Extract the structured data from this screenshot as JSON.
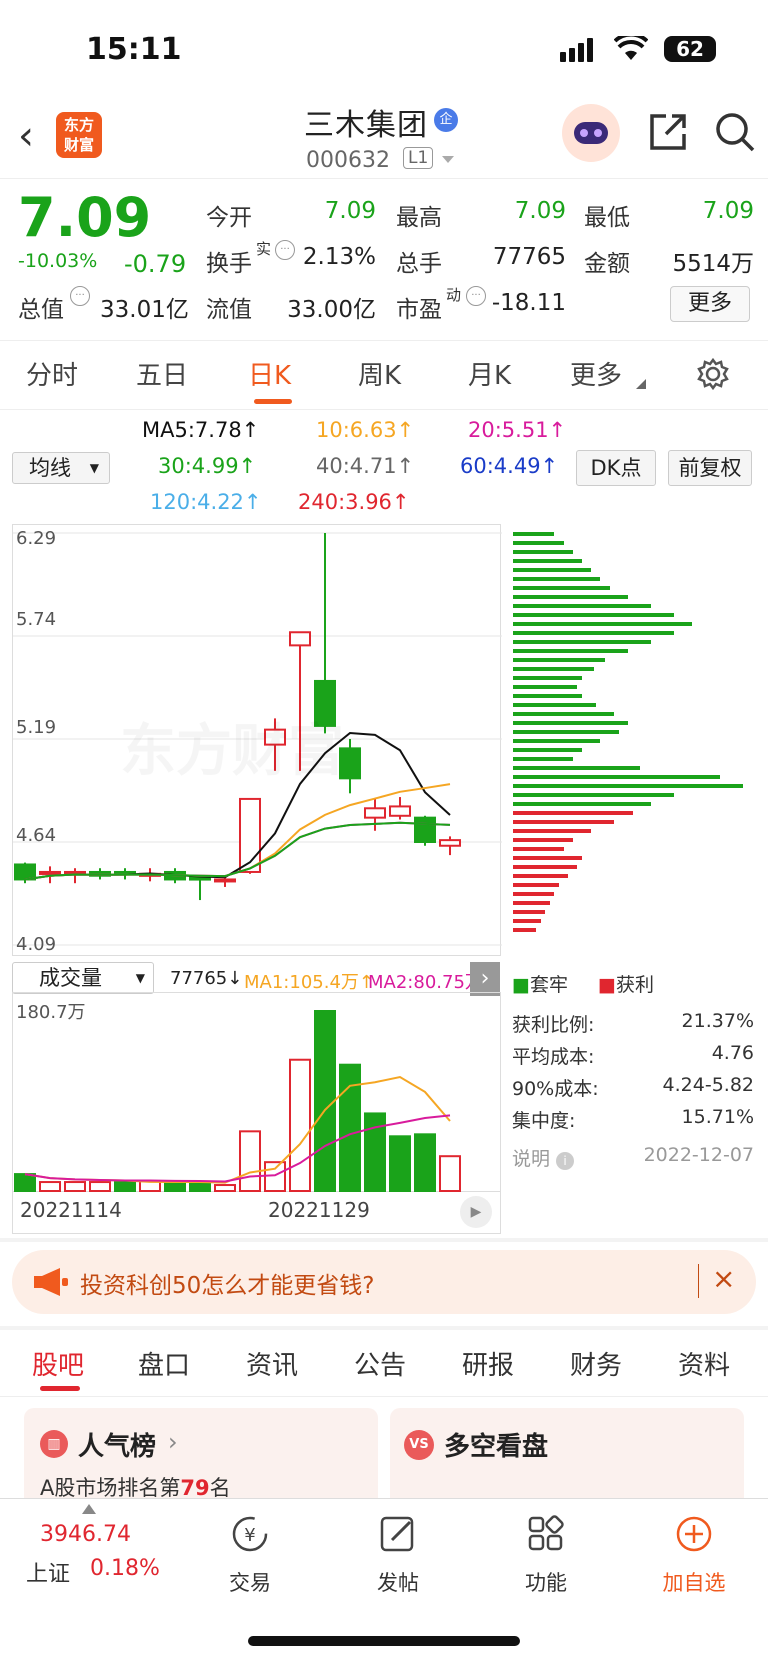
{
  "status_bar": {
    "time": "15:11",
    "battery": "62"
  },
  "header": {
    "logo_text": [
      "东方",
      "财富"
    ],
    "stock_name": "三木集团",
    "badge": "企",
    "stock_code": "000632",
    "level": "L1"
  },
  "quote": {
    "price": "7.09",
    "change_pct": "-10.03%",
    "change": "-0.79",
    "stats": [
      {
        "label": "今开",
        "value": "7.09"
      },
      {
        "label": "最高",
        "value": "7.09"
      },
      {
        "label": "最低",
        "value": "7.09"
      },
      {
        "label": "换手",
        "value": "2.13%"
      },
      {
        "label": "总手",
        "value": "77765"
      },
      {
        "label": "金额",
        "value": "5514万"
      },
      {
        "label": "总值",
        "value": "33.01亿"
      },
      {
        "label": "流值",
        "value": "33.00亿"
      },
      {
        "label": "市盈",
        "value": "-18.11"
      }
    ],
    "sup_shi": "实",
    "sup_dong": "动",
    "more_label": "更多"
  },
  "kline_tabs": [
    "分时",
    "五日",
    "日K",
    "周K",
    "月K",
    "更多"
  ],
  "ma": {
    "selector": "均线",
    "items": [
      {
        "text": "MA5:7.78↑",
        "color": "#111111"
      },
      {
        "text": "10:6.63↑",
        "color": "#f5a623"
      },
      {
        "text": "20:5.51↑",
        "color": "#d81b9c"
      },
      {
        "text": "30:4.99↑",
        "color": "#1aa31a"
      },
      {
        "text": "40:4.71↑",
        "color": "#666666"
      },
      {
        "text": "60:4.49↑",
        "color": "#1a3cc8"
      },
      {
        "text": "120:4.22↑",
        "color": "#4aaee8"
      },
      {
        "text": "240:3.96↑",
        "color": "#e0262f"
      }
    ],
    "dk_label": "DK点",
    "restore_label": "前复权"
  },
  "chart_data": {
    "type": "candlestick",
    "y_ticks": [
      "6.29",
      "5.74",
      "5.19",
      "4.64",
      "4.09"
    ],
    "ylim": [
      4.09,
      6.29
    ],
    "watermark": "东方财富",
    "candles": [
      {
        "o": 4.52,
        "c": 4.44,
        "h": 4.53,
        "l": 4.42
      },
      {
        "o": 4.47,
        "c": 4.48,
        "h": 4.51,
        "l": 4.42
      },
      {
        "o": 4.47,
        "c": 4.48,
        "h": 4.5,
        "l": 4.42
      },
      {
        "o": 4.48,
        "c": 4.46,
        "h": 4.5,
        "l": 4.44
      },
      {
        "o": 4.48,
        "c": 4.47,
        "h": 4.5,
        "l": 4.44
      },
      {
        "o": 4.47,
        "c": 4.47,
        "h": 4.5,
        "l": 4.43
      },
      {
        "o": 4.48,
        "c": 4.44,
        "h": 4.5,
        "l": 4.42
      },
      {
        "o": 4.45,
        "c": 4.44,
        "h": 4.46,
        "l": 4.33
      },
      {
        "o": 4.43,
        "c": 4.44,
        "h": 4.46,
        "l": 4.4
      },
      {
        "o": 4.48,
        "c": 4.87,
        "h": 4.87,
        "l": 4.47
      },
      {
        "o": 5.16,
        "c": 5.24,
        "h": 5.3,
        "l": 5.02
      },
      {
        "o": 5.69,
        "c": 5.76,
        "h": 5.76,
        "l": 5.02
      },
      {
        "o": 5.5,
        "c": 5.26,
        "h": 6.29,
        "l": 5.22
      },
      {
        "o": 5.14,
        "c": 4.98,
        "h": 5.19,
        "l": 4.9
      },
      {
        "o": 4.77,
        "c": 4.82,
        "h": 4.87,
        "l": 4.7
      },
      {
        "o": 4.78,
        "c": 4.83,
        "h": 4.88,
        "l": 4.76
      },
      {
        "o": 4.77,
        "c": 4.64,
        "h": 4.78,
        "l": 4.62
      },
      {
        "o": 4.62,
        "c": 4.65,
        "h": 4.67,
        "l": 4.57
      }
    ],
    "volume": {
      "selector": "成交量",
      "current": "77765↓",
      "ma1": "MA1:105.4万↑",
      "ma2": "MA2:80.75万↑",
      "max_label": "180.7万",
      "values": [
        17,
        9,
        9,
        9,
        9,
        10,
        8,
        9,
        6,
        60,
        29,
        132,
        181,
        127,
        78,
        55,
        57,
        35
      ],
      "colors": [
        "g",
        "r",
        "r",
        "r",
        "g",
        "r",
        "g",
        "g",
        "r",
        "r",
        "r",
        "r",
        "g",
        "g",
        "g",
        "g",
        "g",
        "r"
      ]
    },
    "x_labels": [
      "20221114",
      "20221129"
    ]
  },
  "chips": {
    "legend": [
      "套牢",
      "获利"
    ],
    "rows": [
      {
        "label": "获利比例:",
        "value": "21.37%"
      },
      {
        "label": "平均成本:",
        "value": "4.76"
      },
      {
        "label": "90%成本:",
        "value": "4.24-5.82"
      },
      {
        "label": "集中度:",
        "value": "15.71%"
      }
    ],
    "note_label": "说明",
    "date": "2022-12-07"
  },
  "banner": {
    "text": "投资科创50怎么才能更省钱?"
  },
  "bottom_tabs": [
    "股吧",
    "盘口",
    "资讯",
    "公告",
    "研报",
    "财务",
    "资料"
  ],
  "cards": {
    "left_title": "人气榜",
    "left_sub_prefix": "A股市场排名第",
    "left_sub_rank": "79",
    "left_sub_suffix": "名",
    "right_title": "多空看盘"
  },
  "navbar": {
    "index_value": "3946.74",
    "index_name": "上证",
    "index_pct": "0.18%",
    "items": [
      "交易",
      "发帖",
      "功能",
      "加自选"
    ]
  }
}
